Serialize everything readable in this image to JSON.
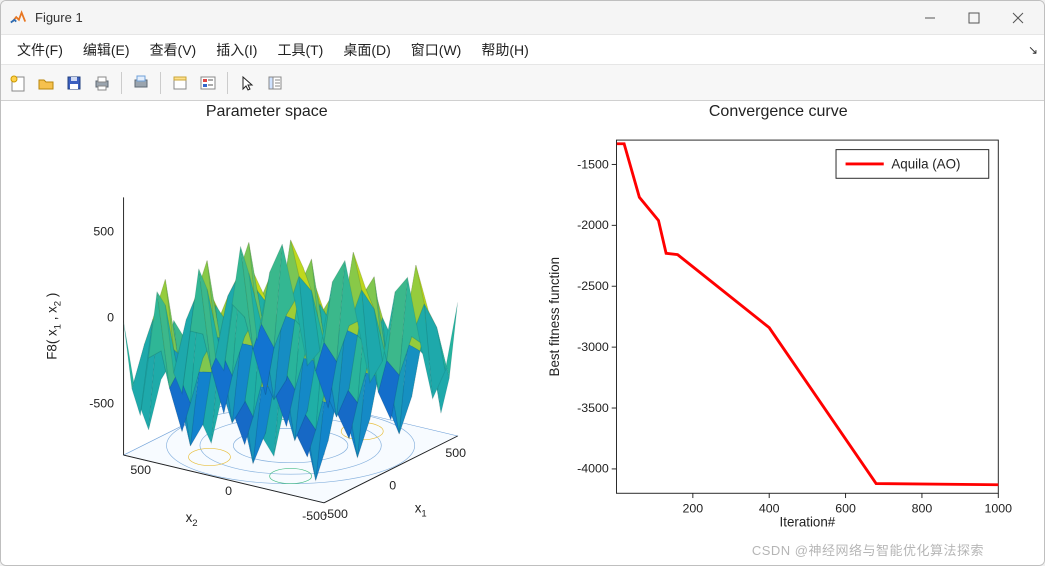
{
  "window": {
    "title": "Figure 1",
    "minimize_icon": "minimize-icon",
    "maximize_icon": "maximize-icon",
    "close_icon": "close-icon"
  },
  "menubar": {
    "items": [
      "文件(F)",
      "编辑(E)",
      "查看(V)",
      "插入(I)",
      "工具(T)",
      "桌面(D)",
      "窗口(W)",
      "帮助(H)"
    ]
  },
  "toolbar": {
    "items": [
      "new-figure-icon",
      "open-icon",
      "save-icon",
      "print-icon",
      "sep",
      "print-preview-icon",
      "sep",
      "hide-tools-icon",
      "legend-icon",
      "sep",
      "pointer-icon",
      "property-editor-icon"
    ]
  },
  "watermark": "CSDN @神经网络与智能优化算法探索",
  "chart_data": [
    {
      "type": "surface-3d",
      "title": "Parameter space",
      "xlabel": "x₁",
      "ylabel": "x₂",
      "zlabel": "F8( x₁ , x₂ )",
      "xlim": [
        -500,
        500
      ],
      "ylim": [
        -500,
        500
      ],
      "zlim": [
        -500,
        500
      ],
      "xticks": [
        -500,
        0,
        500
      ],
      "yticks": [
        -500,
        0,
        500
      ],
      "zticks": [
        -500,
        0,
        500
      ],
      "function": "F8 (Schwefel-like oscillatory surface)",
      "colormap": "parula",
      "contour_floor": true
    },
    {
      "type": "line",
      "title": "Convergence curve",
      "xlabel": "Iteration#",
      "ylabel": "Best fitness function",
      "xlim": [
        0,
        1000
      ],
      "ylim": [
        -4200,
        -1300
      ],
      "xticks": [
        200,
        400,
        600,
        800,
        1000
      ],
      "yticks": [
        -4000,
        -3500,
        -3000,
        -2500,
        -2000,
        -1500
      ],
      "legend": {
        "position": "northeast",
        "entries": [
          "Aquila (AO)"
        ]
      },
      "series": [
        {
          "name": "Aquila (AO)",
          "color": "#ff0000",
          "linewidth": 3,
          "x": [
            1,
            20,
            60,
            60,
            110,
            110,
            130,
            130,
            160,
            160,
            400,
            400,
            680,
            680,
            1000
          ],
          "y": [
            -1330,
            -1330,
            -1770,
            -1770,
            -1960,
            -1960,
            -2230,
            -2230,
            -2240,
            -2240,
            -2840,
            -2840,
            -4120,
            -4120,
            -4130
          ]
        }
      ]
    }
  ]
}
